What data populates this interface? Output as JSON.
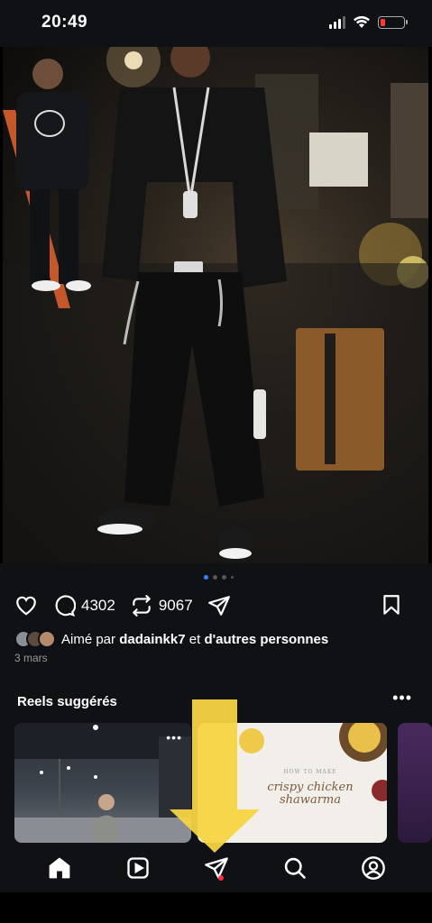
{
  "status_bar": {
    "time": "20:49",
    "icons": [
      "signal-icon",
      "wifi-icon",
      "battery-low-icon"
    ],
    "battery_color": "#ff3b30"
  },
  "post": {
    "image_description_icon": "photo",
    "carousel": {
      "count": 4,
      "active_index": 0
    },
    "comments_count": "4302",
    "reposts_count": "9067",
    "liked_by_prefix": "Aimé par",
    "liked_by_user": "dadainkk7",
    "liked_by_suffix": "et",
    "liked_by_others": "d'autres personnes",
    "date": "3 mars"
  },
  "suggested_reels": {
    "title": "Reels suggérés",
    "more_label": "•••",
    "items": [
      {
        "more_label": "•••"
      },
      {
        "overline": "HOW TO MAKE",
        "title_line1": "crispy chicken",
        "title_line2": "shawarma"
      },
      {}
    ]
  },
  "nav": {
    "items": [
      "home-icon",
      "reels-icon",
      "direct-messages-icon",
      "search-icon",
      "profile-icon"
    ],
    "active": "home-icon",
    "notification_color": "#ff3040"
  },
  "overlay": {
    "arrow_color": "#f5d442"
  }
}
